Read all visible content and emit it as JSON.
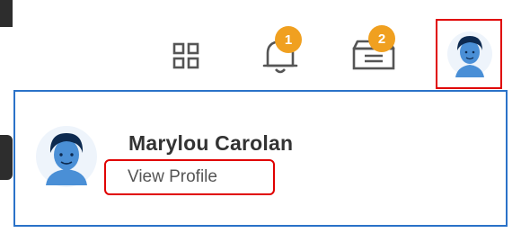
{
  "header": {
    "apps_icon": "grid-icon",
    "notifications": {
      "icon": "bell-icon",
      "badge": "1"
    },
    "inbox": {
      "icon": "inbox-tray-icon",
      "badge": "2"
    },
    "profile": {
      "icon": "user-avatar-icon"
    }
  },
  "profile_menu": {
    "user_name": "Marylou Carolan",
    "view_profile_label": "View Profile"
  },
  "colors": {
    "badge": "#f0a020",
    "highlight": "#e00000",
    "menu_border": "#2a72c8",
    "avatar_face": "#4a8fd6",
    "avatar_hair": "#0d2a50"
  }
}
